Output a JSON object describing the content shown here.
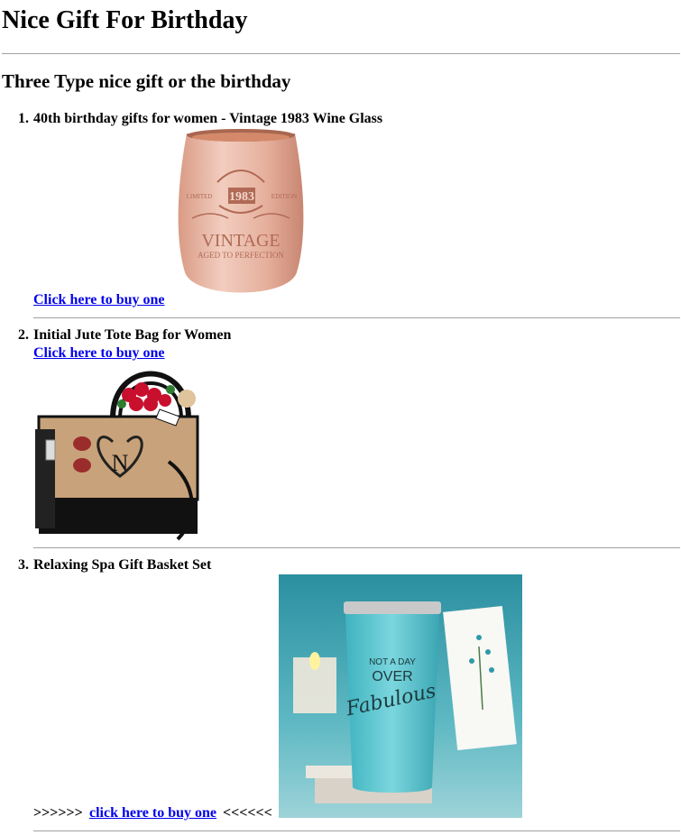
{
  "page": {
    "title": "Nice Gift For Birthday",
    "section_title": "Three Type nice gift or the birthday"
  },
  "items": [
    {
      "number": "1.",
      "title": "40th birthday gifts for women - Vintage 1983 Wine Glass",
      "link_label": "Click here to buy one",
      "image": {
        "kind": "wine-glass",
        "lettering": [
          "LIMITED",
          "1983",
          "EDITION",
          "VINTAGE",
          "AGED TO PERFECTION"
        ],
        "colors": {
          "body": "#e8b7a2",
          "rim": "#c98a70",
          "ink": "#b06a55"
        }
      }
    },
    {
      "number": "2.",
      "title": "Initial Jute Tote Bag for Women",
      "link_label": "Click here to buy one",
      "image": {
        "kind": "tote-bag",
        "lettering": [
          "N"
        ],
        "colors": {
          "jute": "#c8a27a",
          "black": "#111111",
          "roses": "#c8102e"
        }
      }
    },
    {
      "number": "3.",
      "title": "Relaxing Spa Gift Basket Set",
      "link_prefix": ">>>>>> ",
      "link_label": "click here to buy one",
      "link_suffix": "<<<<<<",
      "image": {
        "kind": "tumbler",
        "lettering": [
          "NOT A DAY",
          "OVER",
          "Fabulous"
        ],
        "colors": {
          "tumbler": "#5cc6d1",
          "background": "#3aa3b0"
        }
      }
    }
  ]
}
